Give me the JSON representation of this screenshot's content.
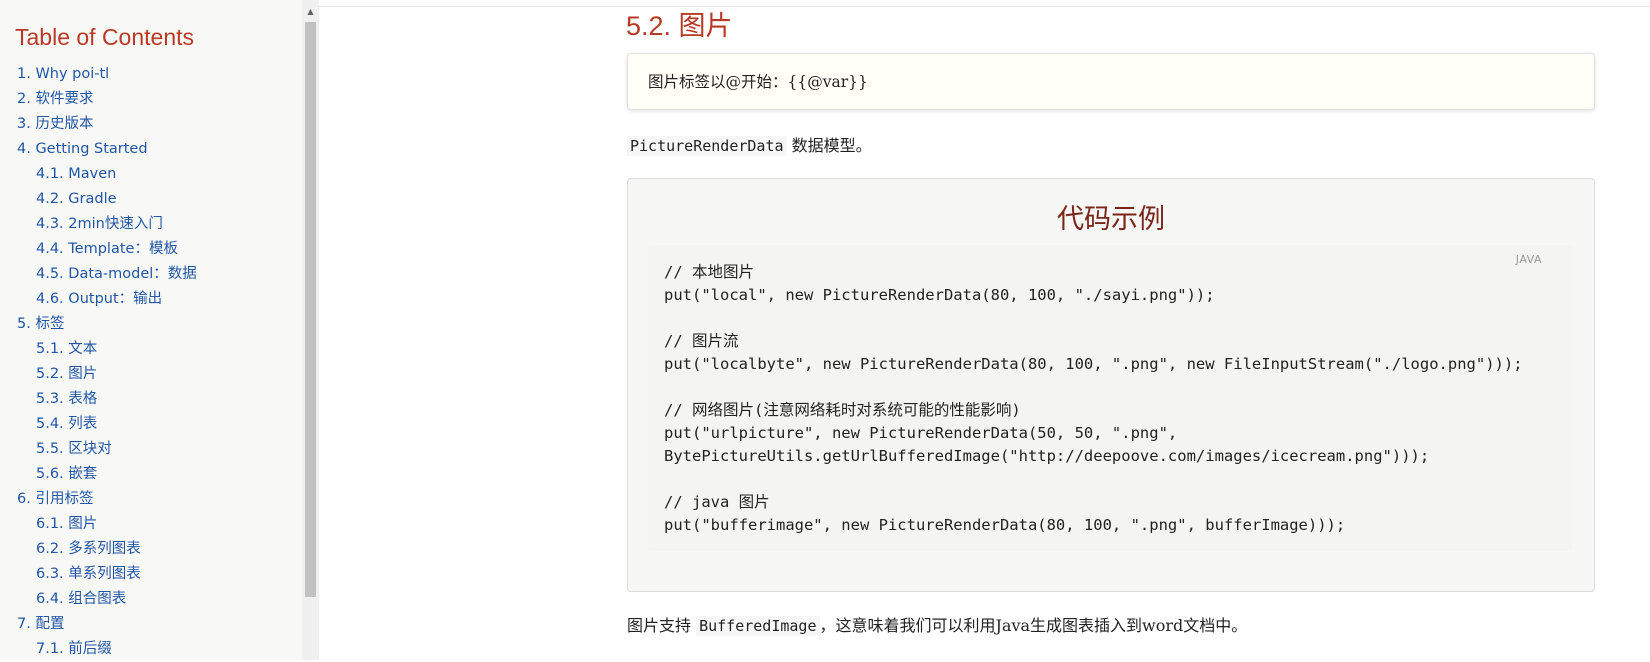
{
  "sidebar": {
    "title": "Table of Contents",
    "items": [
      {
        "level": 1,
        "label": "1. Why poi-tl"
      },
      {
        "level": 1,
        "label": "2. 软件要求"
      },
      {
        "level": 1,
        "label": "3. 历史版本"
      },
      {
        "level": 1,
        "label": "4. Getting Started"
      },
      {
        "level": 2,
        "label": "4.1. Maven"
      },
      {
        "level": 2,
        "label": "4.2. Gradle"
      },
      {
        "level": 2,
        "label": "4.3. 2min快速入门"
      },
      {
        "level": 2,
        "label": "4.4. Template：模板"
      },
      {
        "level": 2,
        "label": "4.5. Data-model：数据"
      },
      {
        "level": 2,
        "label": "4.6. Output：输出"
      },
      {
        "level": 1,
        "label": "5. 标签"
      },
      {
        "level": 2,
        "label": "5.1. 文本"
      },
      {
        "level": 2,
        "label": "5.2. 图片"
      },
      {
        "level": 2,
        "label": "5.3. 表格"
      },
      {
        "level": 2,
        "label": "5.4. 列表"
      },
      {
        "level": 2,
        "label": "5.5. 区块对"
      },
      {
        "level": 2,
        "label": "5.6. 嵌套"
      },
      {
        "level": 1,
        "label": "6. 引用标签"
      },
      {
        "level": 2,
        "label": "6.1. 图片"
      },
      {
        "level": 2,
        "label": "6.2. 多系列图表"
      },
      {
        "level": 2,
        "label": "6.3. 单系列图表"
      },
      {
        "level": 2,
        "label": "6.4. 组合图表"
      },
      {
        "level": 1,
        "label": "7. 配置"
      },
      {
        "level": 2,
        "label": "7.1. 前后缀"
      }
    ]
  },
  "scrollbar": {
    "up_arrow": "▲"
  },
  "main": {
    "heading": "5.2. 图片",
    "note": "图片标签以@开始：{{@var}}",
    "para1": {
      "code": "PictureRenderData",
      "text": " 数据模型。"
    },
    "example": {
      "title": "代码示例",
      "language": "JAVA",
      "lines": [
        "// 本地图片",
        "put(\"local\", new PictureRenderData(80, 100, \"./sayi.png\"));",
        "",
        "// 图片流",
        "put(\"localbyte\", new PictureRenderData(80, 100, \".png\", new FileInputStream(\"./logo.png\")));",
        "",
        "// 网络图片(注意网络耗时对系统可能的性能影响)",
        "put(\"urlpicture\", new PictureRenderData(50, 50, \".png\",",
        "BytePictureUtils.getUrlBufferedImage(\"http://deepoove.com/images/icecream.png\")));",
        "",
        "// java 图片",
        "put(\"bufferimage\", new PictureRenderData(80, 100, \".png\", bufferImage)));"
      ]
    },
    "para2": {
      "prefix": "图片支持 ",
      "code": "BufferedImage",
      "suffix": "，这意味着我们可以利用Java生成图表插入到word文档中。"
    }
  },
  "colors": {
    "accent": "#ba3925",
    "link": "#2156a5",
    "example_title": "#7a2518"
  }
}
